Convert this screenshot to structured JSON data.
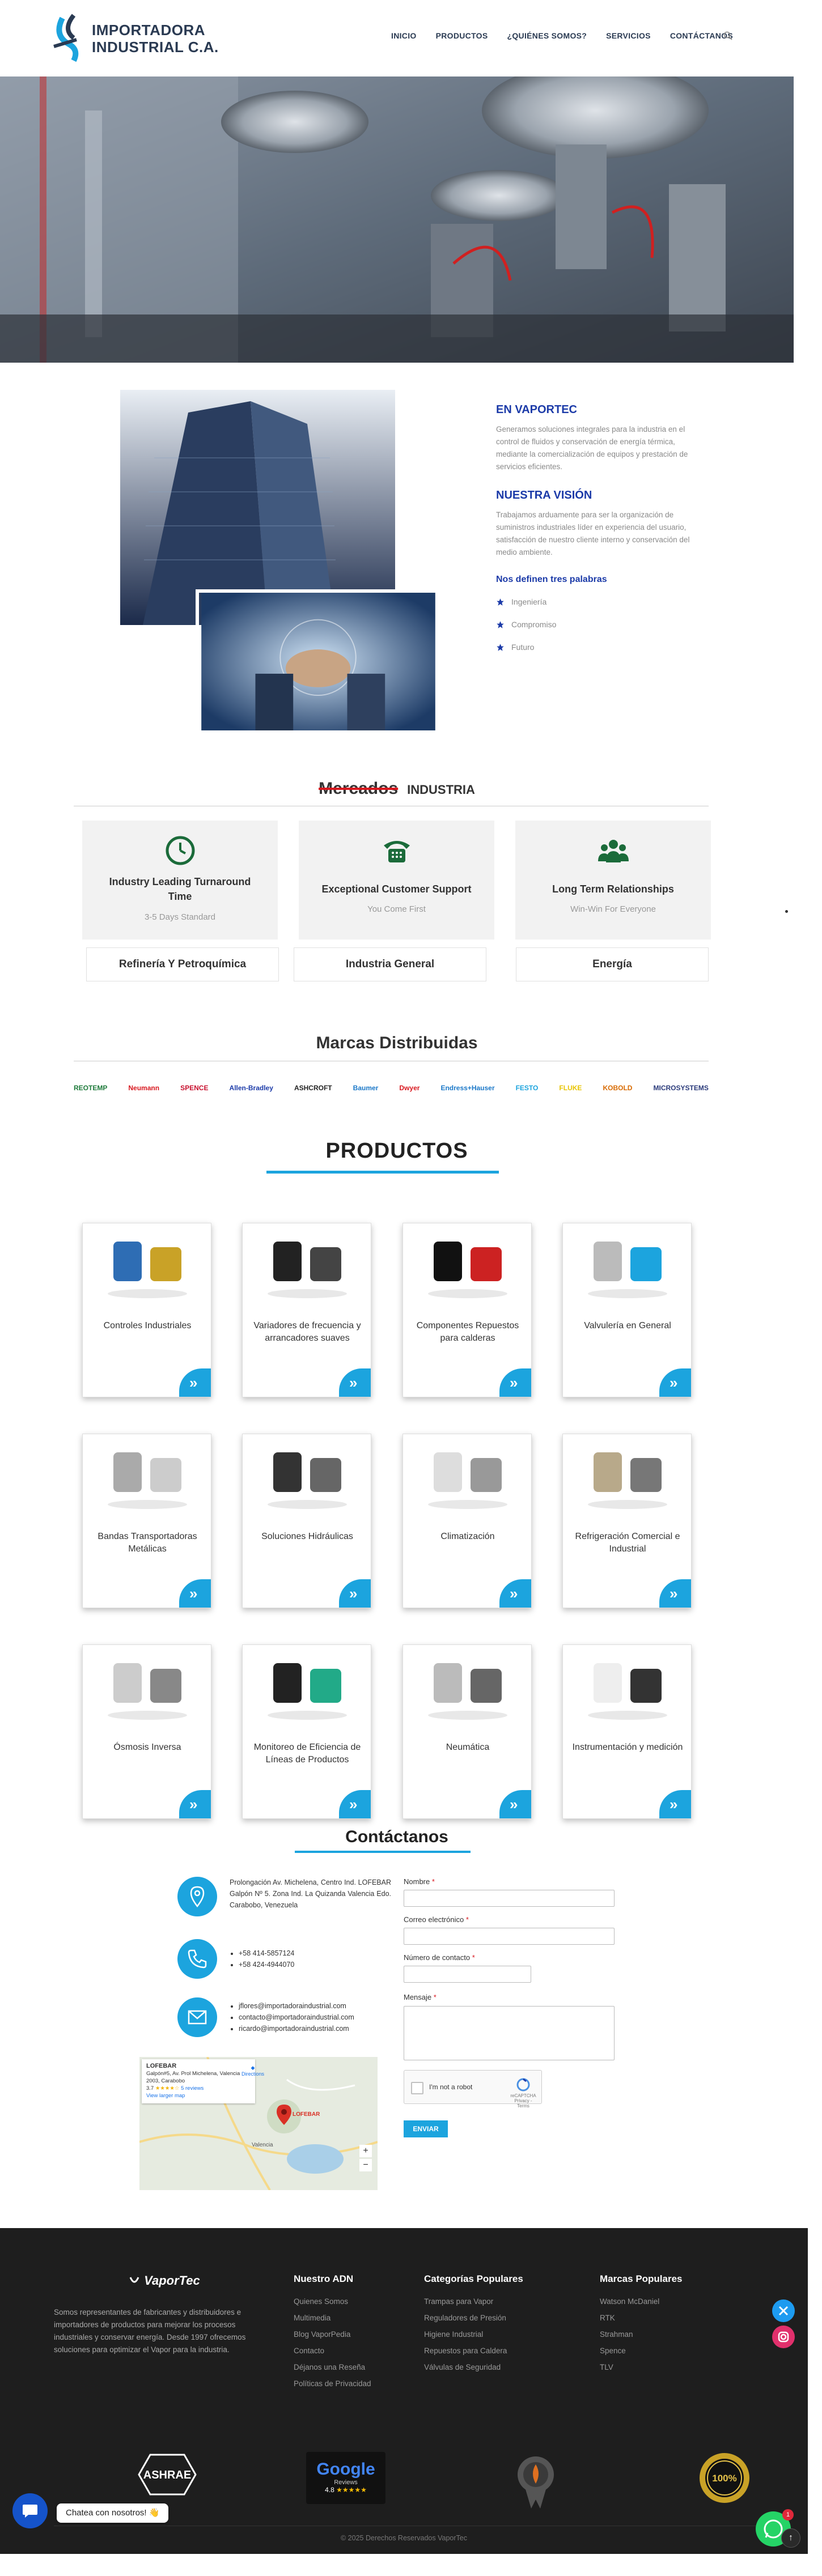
{
  "header": {
    "logo_line1": "IMPORTADORA",
    "logo_line2": "INDUSTRIAL C.A.",
    "nav": [
      "INICIO",
      "PRODUCTOS",
      "¿QUIÉNES SOMOS?",
      "SERVICIOS",
      "CONTÁCTANOS"
    ]
  },
  "about": {
    "heading1": "EN VAPORTEC",
    "text1": "Generamos soluciones integrales para la industria en el control de fluidos y conservación de energía térmica, mediante la comercialización de equipos y prestación de servicios eficientes.",
    "heading2": "NUESTRA VISIÓN",
    "text2": "Trabajamos arduamente para ser la organización de suministros industriales líder en experiencia del usuario, satisfacción de nuestro cliente interno y conservación del medio ambiente.",
    "values_heading": "Nos definen tres palabras",
    "values": [
      "Ingeniería",
      "Compromiso",
      "Futuro"
    ]
  },
  "mercados": {
    "title": "Mercados",
    "subtitle": "INDUSTRIA",
    "features": [
      {
        "title": "Industry Leading Turnaround Time",
        "sub": "3-5 Days Standard",
        "icon": "clock-icon"
      },
      {
        "title": "Exceptional Customer Support",
        "sub": "You Come First",
        "icon": "phone-icon"
      },
      {
        "title": "Long Term Relationships",
        "sub": "Win-Win For Everyone",
        "icon": "people-icon"
      }
    ],
    "markets": [
      "Refinería Y Petroquímica",
      "Industria General",
      "Energía"
    ]
  },
  "marcas": {
    "title": "Marcas Distribuidas",
    "brands": [
      {
        "name": "REOTEMP",
        "color": "#1d7a3a"
      },
      {
        "name": "Neumann",
        "color": "#d8171e"
      },
      {
        "name": "SPENCE",
        "color": "#c8102e"
      },
      {
        "name": "Allen-Bradley",
        "color": "#1b3aa8"
      },
      {
        "name": "ASHCROFT",
        "color": "#222222"
      },
      {
        "name": "Baumer",
        "color": "#1b78c8"
      },
      {
        "name": "Dwyer",
        "color": "#d8171e"
      },
      {
        "name": "Endress+Hauser",
        "color": "#1b78c8"
      },
      {
        "name": "FESTO",
        "color": "#1ca4de"
      },
      {
        "name": "FLUKE",
        "color": "#e8c400"
      },
      {
        "name": "KOBOLD",
        "color": "#d86a00"
      },
      {
        "name": "MICROSYSTEMS",
        "color": "#2a3a7a"
      }
    ]
  },
  "productos": {
    "title": "PRODUCTOS",
    "items": [
      "Controles Industriales",
      "Variadores de frecuencia y arrancadores suaves",
      "Componentes Repuestos para calderas",
      "Valvulería en General",
      "Bandas Transportadoras Metálicas",
      "Soluciones Hidráulicas",
      "Climatización",
      "Refrigeración Comercial e Industrial",
      "Ósmosis Inversa",
      "Monitoreo de Eficiencia de Líneas de Productos",
      "Neumática",
      "Instrumentación y medición"
    ]
  },
  "contact": {
    "title": "Contáctanos",
    "address": "Prolongación Av. Michelena, Centro Ind. LOFEBAR Galpón Nº 5. Zona Ind. La Quizanda Valencia Edo. Carabobo, Venezuela",
    "phones": [
      "+58 414-5857124",
      "+58 424-4944070"
    ],
    "emails": [
      "jflores@importadoraindustrial.com",
      "contacto@importadoraindustrial.com",
      "ricardo@importadoraindustrial.com"
    ],
    "map": {
      "place": "LOFEBAR",
      "addr": "Galpón#5, Av. Prol Michelena, Valencia 2003, Carabobo",
      "rating": "3.7",
      "reviews": "5 reviews",
      "larger": "View larger map",
      "directions": "Directions",
      "label": "LOFEBAR",
      "city": "Valencia"
    },
    "form": {
      "name": "Nombre",
      "email": "Correo electrónico",
      "phone": "Número de contacto",
      "message": "Mensaje",
      "required": "*",
      "captcha": "I'm not a robot",
      "captcha_brand": "reCAPTCHA",
      "captcha_links": "Privacy - Terms",
      "send": "ENVIAR"
    }
  },
  "footer": {
    "logo": "VaporTec",
    "desc": "Somos representantes de fabricantes y distribuidores e importadores de productos para mejorar los procesos industriales y conservar energía. Desde 1997 ofrecemos soluciones para optimizar el Vapor para la industria.",
    "col1": {
      "title": "Nuestro ADN",
      "items": [
        "Quienes Somos",
        "Multimedia",
        "Blog VaporPedia",
        "Contacto",
        "Déjanos una Reseña",
        "Políticas de Privacidad"
      ]
    },
    "col2": {
      "title": "Categorías Populares",
      "items": [
        "Trampas para Vapor",
        "Reguladores de Presión",
        "Higiene Industrial",
        "Repuestos para Caldera",
        "Válvulas de Seguridad"
      ]
    },
    "col3": {
      "title": "Marcas Populares",
      "items": [
        "Watson McDaniel",
        "RTK",
        "Strahman",
        "Spence",
        "TLV"
      ]
    },
    "badges": {
      "ashrae": "ASHRAE",
      "google": "Google",
      "google_sub": "Reviews",
      "google_rating": "4.8",
      "award": "100%"
    },
    "copyright": "© 2025 Derechos Reservados VaporTec",
    "chat": "Chatea con nosotros! 👋",
    "wa_count": "1"
  }
}
